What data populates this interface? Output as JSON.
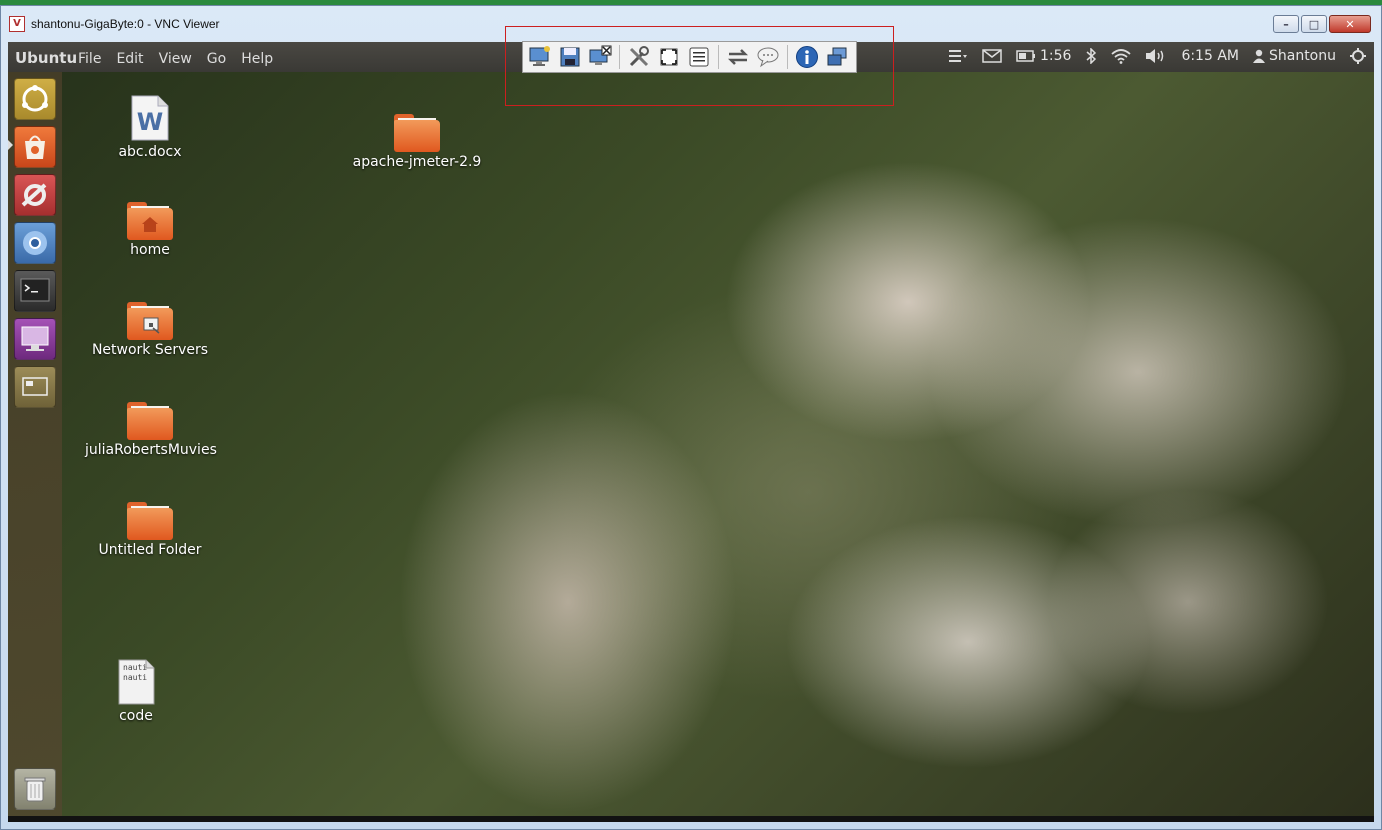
{
  "window": {
    "title": "shantonu-GigaByte:0 - VNC Viewer",
    "app_icon_text": "V",
    "controls": [
      "minimize",
      "maximize",
      "close"
    ]
  },
  "panel": {
    "brand": "Ubuntu",
    "menu": [
      "File",
      "Edit",
      "View",
      "Go",
      "Help"
    ],
    "indicators": {
      "battery_time": "1:56",
      "clock": "6:15 AM",
      "user": "Shantonu"
    }
  },
  "vnc_toolbar": {
    "buttons": [
      {
        "name": "new-connection-icon"
      },
      {
        "name": "save-icon"
      },
      {
        "name": "disconnect-icon"
      },
      {
        "name": "options-icon"
      },
      {
        "name": "fullscreen-icon"
      },
      {
        "name": "ctrl-alt-del-icon"
      },
      {
        "name": "transfer-files-icon"
      },
      {
        "name": "chat-icon"
      },
      {
        "name": "info-icon"
      },
      {
        "name": "switch-windows-icon"
      }
    ],
    "highlight_color": "#cc1f1f"
  },
  "launcher": {
    "items": [
      {
        "name": "dash-home-icon",
        "color": "#c7a43a"
      },
      {
        "name": "ubuntu-software-center-icon",
        "color": "#e2632a"
      },
      {
        "name": "system-settings-icon",
        "color": "#c84a4a"
      },
      {
        "name": "chromium-icon",
        "color": "#4b82c3"
      },
      {
        "name": "terminal-icon",
        "color": "#3b3b3b"
      },
      {
        "name": "remote-desktop-icon",
        "color": "#8c3c9c"
      },
      {
        "name": "workspace-switcher-icon",
        "color": "#8b7c4a"
      },
      {
        "name": "trash-icon",
        "color": "#9a9a8a"
      }
    ]
  },
  "desktop_icons": [
    {
      "label": "abc.docx",
      "kind": "word-document-icon"
    },
    {
      "label": "apache-jmeter-2.9",
      "kind": "folder-icon"
    },
    {
      "label": "home",
      "kind": "home-folder-icon"
    },
    {
      "label": "Network Servers",
      "kind": "network-folder-icon"
    },
    {
      "label": "juliaRobertsMuvies",
      "kind": "folder-icon"
    },
    {
      "label": "Untitled Folder",
      "kind": "folder-icon"
    },
    {
      "label": "code",
      "kind": "text-file-icon",
      "preview_text": "nauti nauti"
    }
  ]
}
